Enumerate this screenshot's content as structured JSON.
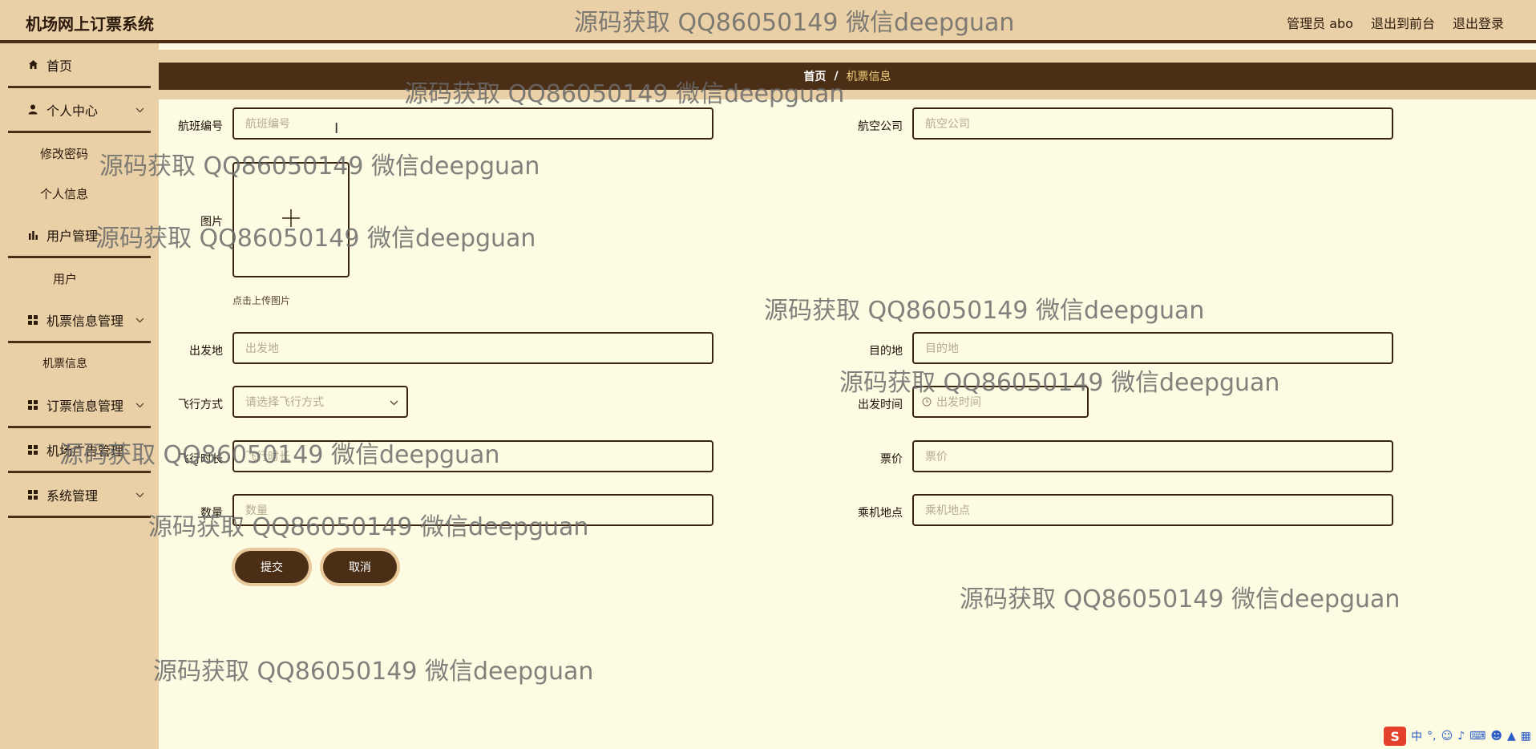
{
  "header": {
    "app_title": "机场网上订票系统",
    "admin_label": "管理员 abo",
    "to_frontend": "退出到前台",
    "logout": "退出登录"
  },
  "sidebar": {
    "home": "首页",
    "personal_center": "个人中心",
    "change_password": "修改密码",
    "personal_info": "个人信息",
    "user_management": "用户管理",
    "users": "用户",
    "ticket_info_management": "机票信息管理",
    "ticket_info": "机票信息",
    "order_info_management": "订票信息管理",
    "airport_ad_management": "机场广告管理",
    "system_management": "系统管理"
  },
  "breadcrumb": {
    "home": "首页",
    "separator": "/",
    "current": "机票信息"
  },
  "form": {
    "flight_no_label": "航班编号",
    "flight_no_placeholder": "航班编号",
    "airline_label": "航空公司",
    "airline_placeholder": "航空公司",
    "image_label": "图片",
    "upload_hint": "点击上传图片",
    "departure_label": "出发地",
    "departure_placeholder": "出发地",
    "destination_label": "目的地",
    "destination_placeholder": "目的地",
    "flight_mode_label": "飞行方式",
    "flight_mode_placeholder": "请选择飞行方式",
    "depart_time_label": "出发时间",
    "depart_time_placeholder": "出发时间",
    "duration_label": "飞行时长",
    "duration_placeholder": "飞行时长",
    "price_label": "票价",
    "price_placeholder": "票价",
    "quantity_label": "数量",
    "quantity_placeholder": "数量",
    "boarding_label": "乘机地点",
    "boarding_placeholder": "乘机地点",
    "submit": "提交",
    "cancel": "取消"
  },
  "watermark": "源码获取 QQ86050149 微信deepguan",
  "colors": {
    "header_bg": "#ead0a6",
    "accent_dark": "#4a2e16",
    "page_bg": "#fdfce2",
    "crumb_current": "#f1d07a"
  },
  "icons": {
    "home": "home-icon",
    "person": "person-icon",
    "chart": "bar-chart-icon",
    "grid": "grid-icon",
    "chevron": "chevron-down-icon",
    "plus": "plus-icon",
    "clock": "clock-icon"
  }
}
